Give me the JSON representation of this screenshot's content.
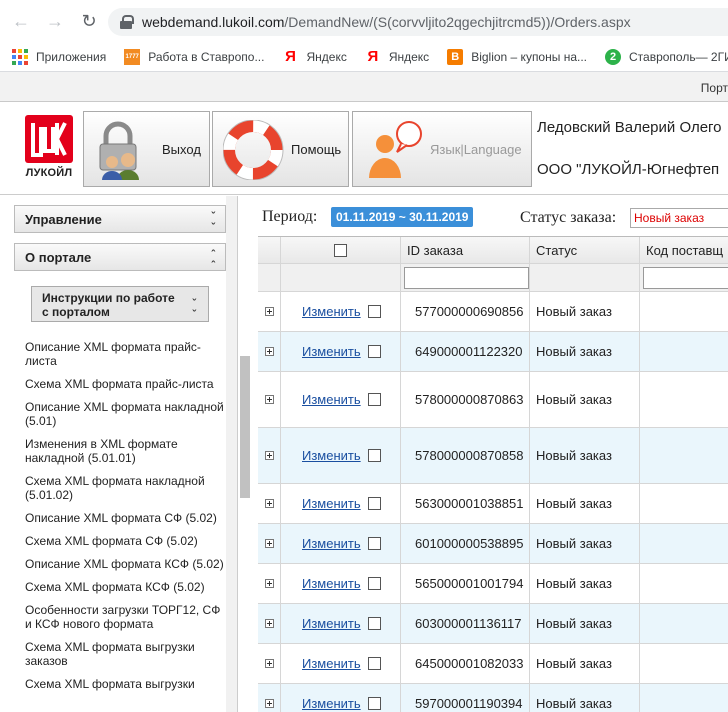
{
  "browser": {
    "url_host": "webdemand.lukoil.com",
    "url_path": "/DemandNew/(S(corvvljito2qgechjitrcmd5))/Orders.aspx",
    "bookmarks": [
      {
        "label": "Приложения",
        "icon": "apps-icon"
      },
      {
        "label": "Работа в Ставропо...",
        "icon": "1777-icon",
        "icon_text": "1777"
      },
      {
        "label": "Яндекс",
        "icon": "yandex-icon",
        "icon_text": "Я"
      },
      {
        "label": "Яндекс",
        "icon": "yandex-icon",
        "icon_text": "Я"
      },
      {
        "label": "Biglion – купоны на...",
        "icon": "biglion-icon",
        "icon_text": "B"
      },
      {
        "label": "Ставрополь— 2ГИС",
        "icon": "2gis-icon",
        "icon_text": "2"
      }
    ]
  },
  "topstrip": {
    "text": "Порт"
  },
  "header": {
    "logo_text": "ЛУКОЙЛ",
    "buttons": {
      "exit": "Выход",
      "help": "Помощь",
      "language": "Язык|Language"
    },
    "user_name": "Ледовский Валерий Олего",
    "user_org": "ООО \"ЛУКОЙЛ-Югнефтеп"
  },
  "sidebar": {
    "panels": {
      "management": "Управление",
      "about": "О портале"
    },
    "instructions_button": "Инструкции по работе с порталом",
    "links": [
      "Описание XML формата прайс-листа",
      "Схема XML формата прайс-листа",
      "Описание XML формата накладной (5.01)",
      "Изменения в XML формате накладной (5.01.01)",
      "Схема XML формата накладной (5.01.02)",
      "Описание XML формата СФ (5.02)",
      "Схема XML формата СФ (5.02)",
      "Описание XML формата КСФ (5.02)",
      "Схема XML формата КСФ (5.02)",
      "Особенности загрузки ТОРГ12, СФ и КСФ нового формата",
      "Схема XML формата выгрузки заказов",
      "Схема XML формата выгрузки"
    ]
  },
  "filters": {
    "period_label": "Период:",
    "period_value": "01.11.2019 ~ 30.11.2019",
    "status_label": "Статус заказа:",
    "status_value": "Новый заказ"
  },
  "grid": {
    "columns": {
      "order_id": "ID заказа",
      "status": "Статус",
      "supplier_code": "Код поставщ"
    },
    "edit_label": "Изменить",
    "rows": [
      {
        "order_id": "577000000690856",
        "status": "Новый заказ"
      },
      {
        "order_id": "649000001122320",
        "status": "Новый заказ"
      },
      {
        "order_id": "578000000870863",
        "status": "Новый заказ"
      },
      {
        "order_id": "578000000870858",
        "status": "Новый заказ"
      },
      {
        "order_id": "563000001038851",
        "status": "Новый заказ"
      },
      {
        "order_id": "601000000538895",
        "status": "Новый заказ"
      },
      {
        "order_id": "565000001001794",
        "status": "Новый заказ"
      },
      {
        "order_id": "603000001136117",
        "status": "Новый заказ"
      },
      {
        "order_id": "645000001082033",
        "status": "Новый заказ"
      },
      {
        "order_id": "597000001190394",
        "status": "Новый заказ"
      }
    ]
  },
  "colors": {
    "brand_red": "#e3001b",
    "period_blue": "#3b8fd9",
    "row_alt": "#eaf6fc",
    "link_blue": "#1a4fa0"
  }
}
